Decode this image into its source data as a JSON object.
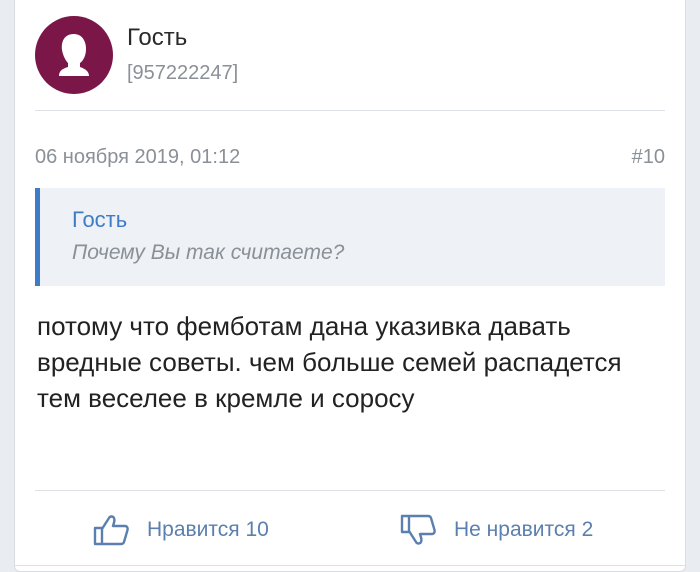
{
  "author": {
    "name": "Гость",
    "id": "[957222247]",
    "avatar_icon": "user-silhouette-icon",
    "avatar_color": "#7a1648"
  },
  "post": {
    "date": "06 ноября 2019, 01:12",
    "number": "#10",
    "quote": {
      "author": "Гость",
      "text": "Почему Вы так считаете?"
    },
    "text": "потому что фемботам дана указивка давать вредные советы. чем больше семей распадется тем веселее в кремле и соросу"
  },
  "actions": {
    "like": {
      "icon": "thumbs-up-icon",
      "label": "Нравится 10"
    },
    "dislike": {
      "icon": "thumbs-down-icon",
      "label": "Не нравится 2"
    }
  },
  "colors": {
    "accent": "#3f7cc8",
    "action": "#5b7fae",
    "muted": "#8a9097"
  }
}
